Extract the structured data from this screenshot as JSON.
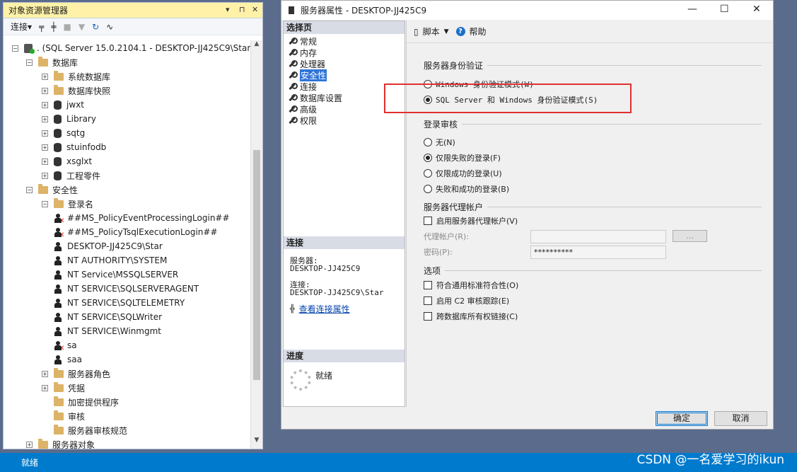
{
  "object_explorer": {
    "title": "对象资源管理器",
    "title_controls": [
      "▾",
      "⊓",
      "✕"
    ],
    "toolbar": {
      "connect": "连接▾"
    },
    "tree": [
      {
        "label": ". (SQL Server 15.0.2104.1 - DESKTOP-JJ425C9\\Star)",
        "icon": "server-icon",
        "expander": "⊟",
        "level": 0
      },
      {
        "label": "数据库",
        "icon": "folder-icon",
        "expander": "⊟",
        "level": 1
      },
      {
        "label": "系统数据库",
        "icon": "folder-icon",
        "expander": "⊞",
        "level": 2
      },
      {
        "label": "数据库快照",
        "icon": "folder-icon",
        "expander": "⊞",
        "level": 2
      },
      {
        "label": "jwxt",
        "icon": "database-icon",
        "expander": "⊞",
        "level": 2
      },
      {
        "label": "Library",
        "icon": "database-icon",
        "expander": "⊞",
        "level": 2
      },
      {
        "label": "sqtg",
        "icon": "database-icon",
        "expander": "⊞",
        "level": 2
      },
      {
        "label": "stuinfodb",
        "icon": "database-icon",
        "expander": "⊞",
        "level": 2
      },
      {
        "label": "xsglxt",
        "icon": "database-icon",
        "expander": "⊞",
        "level": 2
      },
      {
        "label": "工程零件",
        "icon": "database-icon",
        "expander": "⊞",
        "level": 2
      },
      {
        "label": "安全性",
        "icon": "folder-icon",
        "expander": "⊟",
        "level": 1
      },
      {
        "label": "登录名",
        "icon": "folder-icon",
        "expander": "⊟",
        "level": 2
      },
      {
        "label": "##MS_PolicyEventProcessingLogin##",
        "icon": "disabled-login-icon",
        "expander": "",
        "level": 3
      },
      {
        "label": "##MS_PolicyTsqlExecutionLogin##",
        "icon": "disabled-login-icon",
        "expander": "",
        "level": 3
      },
      {
        "label": "DESKTOP-JJ425C9\\Star",
        "icon": "login-icon",
        "expander": "",
        "level": 3
      },
      {
        "label": "NT AUTHORITY\\SYSTEM",
        "icon": "login-icon",
        "expander": "",
        "level": 3
      },
      {
        "label": "NT Service\\MSSQLSERVER",
        "icon": "login-icon",
        "expander": "",
        "level": 3
      },
      {
        "label": "NT SERVICE\\SQLSERVERAGENT",
        "icon": "login-icon",
        "expander": "",
        "level": 3
      },
      {
        "label": "NT SERVICE\\SQLTELEMETRY",
        "icon": "login-icon",
        "expander": "",
        "level": 3
      },
      {
        "label": "NT SERVICE\\SQLWriter",
        "icon": "login-icon",
        "expander": "",
        "level": 3
      },
      {
        "label": "NT SERVICE\\Winmgmt",
        "icon": "login-icon",
        "expander": "",
        "level": 3
      },
      {
        "label": "sa",
        "icon": "disabled-login-icon",
        "expander": "",
        "level": 3
      },
      {
        "label": "saa",
        "icon": "login-icon",
        "expander": "",
        "level": 3
      },
      {
        "label": "服务器角色",
        "icon": "folder-icon",
        "expander": "⊞",
        "level": 2
      },
      {
        "label": "凭据",
        "icon": "folder-icon",
        "expander": "⊞",
        "level": 2
      },
      {
        "label": "加密提供程序",
        "icon": "folder-icon",
        "expander": "",
        "level": 2
      },
      {
        "label": "审核",
        "icon": "folder-icon",
        "expander": "",
        "level": 2
      },
      {
        "label": "服务器审核规范",
        "icon": "folder-icon",
        "expander": "",
        "level": 2
      },
      {
        "label": "服务器对象",
        "icon": "folder-icon",
        "expander": "⊞",
        "level": 1
      }
    ]
  },
  "dialog": {
    "title": "服务器属性 - DESKTOP-JJ425C9",
    "window_controls": [
      "—",
      "☐",
      "✕"
    ],
    "select_page_header": "选择页",
    "pages": [
      "常规",
      "内存",
      "处理器",
      "安全性",
      "连接",
      "数据库设置",
      "高级",
      "权限"
    ],
    "selected_page": "安全性",
    "connection_header": "连接",
    "server_label": "服务器:",
    "server_value": "DESKTOP-JJ425C9",
    "connection_label": "连接:",
    "connection_value": "DESKTOP-JJ425C9\\Star",
    "view_conn_props": "查看连接属性",
    "progress_header": "进度",
    "progress_status": "就绪",
    "toolbar": {
      "script": "脚本",
      "help": "帮助"
    },
    "auth_group": "服务器身份验证",
    "auth_options": [
      "Windows 身份验证模式(W)",
      "SQL Server 和 Windows 身份验证模式(S)"
    ],
    "auth_selected": 1,
    "audit_group": "登录审核",
    "audit_options": [
      "无(N)",
      "仅限失败的登录(F)",
      "仅限成功的登录(U)",
      "失败和成功的登录(B)"
    ],
    "audit_selected": 1,
    "proxy_group": "服务器代理帐户",
    "proxy_enable": "启用服务器代理帐户(V)",
    "proxy_account_label": "代理帐户(R):",
    "password_label": "密码(P):",
    "password_value": "**********",
    "proxy_browse": "...",
    "options_group": "选项",
    "options": [
      "符合通用标准符合性(O)",
      "启用 C2 审核跟踪(E)",
      "跨数据库所有权链接(C)"
    ],
    "ok": "确定",
    "cancel": "取消"
  },
  "status_bar": {
    "text": "就绪"
  },
  "watermark": "CSDN @一名爱学习的ikun"
}
